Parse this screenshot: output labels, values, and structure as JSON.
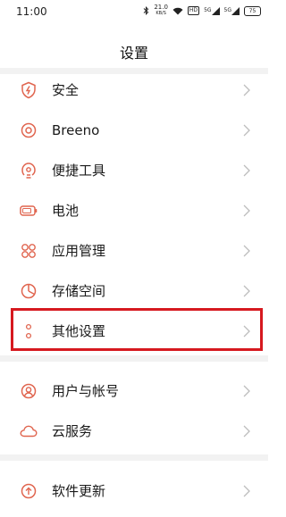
{
  "status_bar": {
    "time": "11:00",
    "net_speed_value": "21.0",
    "net_speed_unit": "KB/S",
    "hd_label": "HD",
    "signal_label_1": "5G",
    "signal_label_2": "5G",
    "battery": "75"
  },
  "header": {
    "title": "设置"
  },
  "menu": {
    "security": "安全",
    "breeno": "Breeno",
    "tools": "便捷工具",
    "battery": "电池",
    "apps": "应用管理",
    "storage": "存储空间",
    "other_settings": "其他设置",
    "account": "用户与帐号",
    "cloud": "云服务",
    "update": "软件更新"
  },
  "colors": {
    "accent_icon": "#e0654f",
    "highlight_border": "#d6191f",
    "chevron": "#bdbdbd",
    "divider": "#f2f2f2"
  },
  "icons": {
    "security": "shield-icon",
    "breeno": "breeno-icon",
    "tools": "tools-icon",
    "battery": "battery-icon",
    "apps": "app-grid-icon",
    "storage": "pie-chart-icon",
    "other_settings": "more-dots-icon",
    "account": "user-icon",
    "cloud": "cloud-icon",
    "update": "upgrade-icon"
  }
}
